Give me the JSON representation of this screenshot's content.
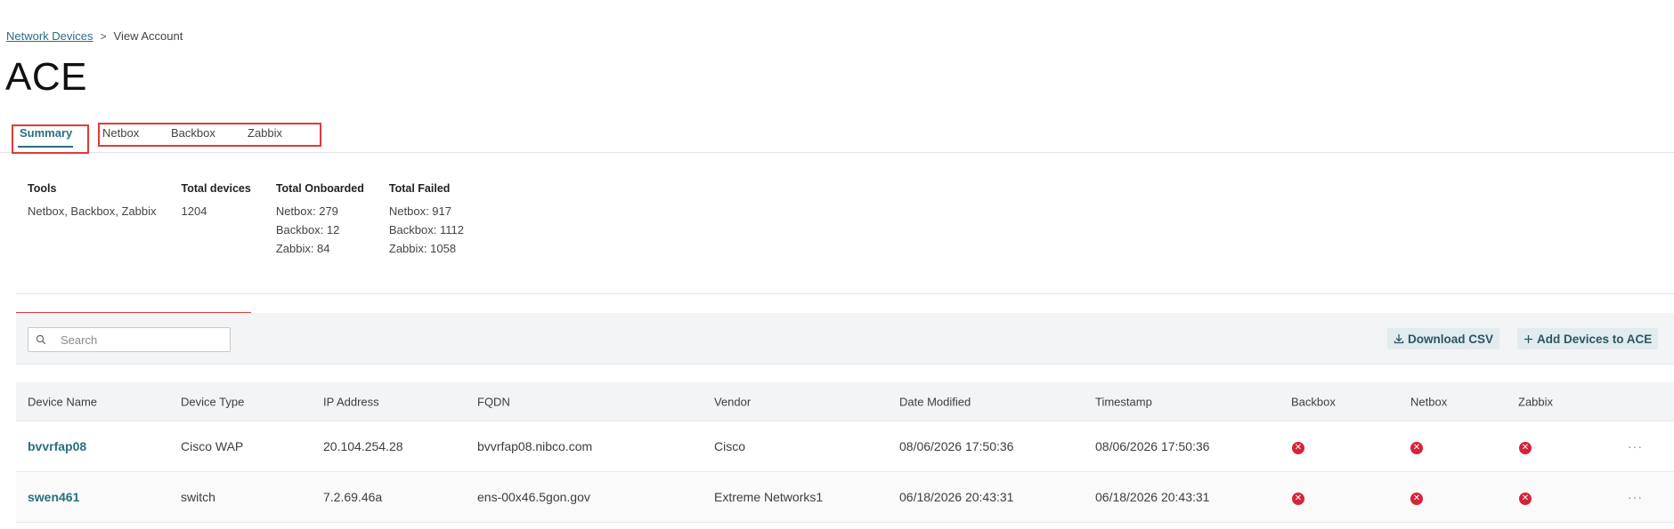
{
  "breadcrumb": {
    "parent": "Network Devices",
    "separator": ">",
    "current": "View Account"
  },
  "page_title": "ACE",
  "tabs": [
    {
      "label": "Summary",
      "active": true
    },
    {
      "label": "Netbox",
      "active": false
    },
    {
      "label": "Backbox",
      "active": false
    },
    {
      "label": "Zabbix",
      "active": false
    }
  ],
  "summary": {
    "tools": {
      "header": "Tools",
      "values": [
        "Netbox, Backbox, Zabbix"
      ]
    },
    "total_devices": {
      "header": "Total devices",
      "values": [
        "1204"
      ]
    },
    "total_onboarded": {
      "header": "Total Onboarded",
      "values": [
        "Netbox: 279",
        "Backbox: 12",
        "Zabbix: 84"
      ]
    },
    "total_failed": {
      "header": "Total Failed",
      "values": [
        "Netbox: 917",
        "Backbox: 1112",
        "Zabbix: 1058"
      ]
    }
  },
  "toolbar": {
    "search_placeholder": "Search",
    "download_label": "Download CSV",
    "add_label": "Add Devices to ACE"
  },
  "table": {
    "columns": [
      "Device Name",
      "Device Type",
      "IP Address",
      "FQDN",
      "Vendor",
      "Date Modified",
      "Timestamp",
      "Backbox",
      "Netbox",
      "Zabbix"
    ],
    "rows": [
      {
        "device_name": "bvvrfap08",
        "device_type": "Cisco WAP",
        "ip": "20.104.254.28",
        "fqdn": "bvvrfap08.nibco.com",
        "vendor": "Cisco",
        "date_modified": "08/06/2026 17:50:36",
        "timestamp": "08/06/2026 17:50:36",
        "backbox": "failed",
        "netbox": "failed",
        "zabbix": "failed",
        "more": "···"
      },
      {
        "device_name": "swen461",
        "device_type": "switch",
        "ip": "7.2.69.46a",
        "fqdn": "ens-00x46.5gon.gov",
        "vendor": "Extreme Networks1",
        "date_modified": "06/18/2026 20:43:31",
        "timestamp": "06/18/2026 20:43:31",
        "backbox": "failed",
        "netbox": "failed",
        "zabbix": "failed",
        "more": "···"
      }
    ]
  },
  "colors": {
    "accent": "#2a6f7f",
    "error": "#d6233a",
    "highlight": "#e03a3a"
  }
}
